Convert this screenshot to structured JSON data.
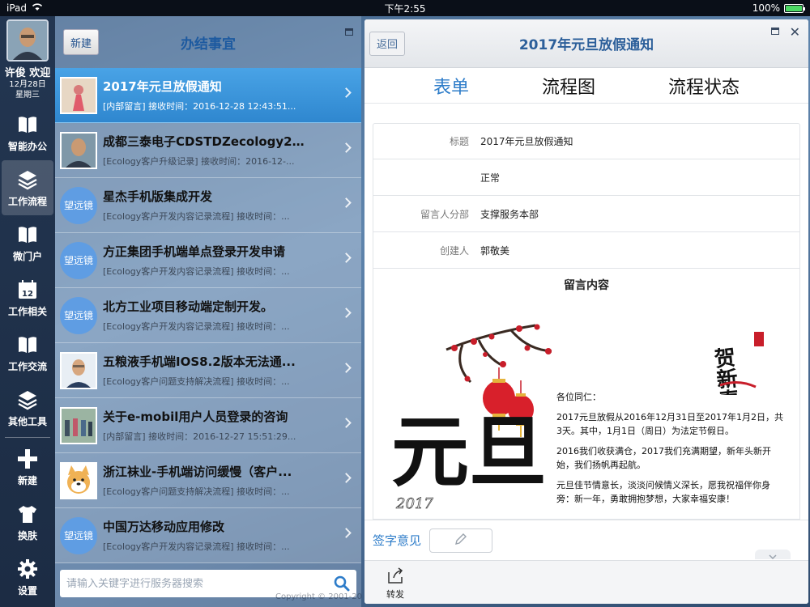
{
  "status": {
    "device": "iPad",
    "time": "下午2:55",
    "battery": "100%"
  },
  "user": {
    "name": "许俊 欢迎",
    "date": "12月28日",
    "weekday": "星期三"
  },
  "rail": [
    {
      "label": "智能办公",
      "icon": "book-icon"
    },
    {
      "label": "工作流程",
      "icon": "layers-icon"
    },
    {
      "label": "微门户",
      "icon": "book-icon"
    },
    {
      "label": "工作相关",
      "icon": "calendar-icon",
      "badge": "12"
    },
    {
      "label": "工作交流",
      "icon": "book-icon"
    },
    {
      "label": "其他工具",
      "icon": "layers-icon"
    },
    {
      "label": "新建",
      "icon": "plus-icon"
    },
    {
      "label": "换肤",
      "icon": "shirt-icon"
    },
    {
      "label": "设置",
      "icon": "gear-icon"
    }
  ],
  "list": {
    "new_label": "新建",
    "title": "办结事宜",
    "logo_text": "望远镜",
    "search_placeholder": "请输入关键字进行服务器搜索",
    "items": [
      {
        "title": "2017年元旦放假通知",
        "sub": "[内部留言]   接收时间：2016-12-28 12:43:51..."
      },
      {
        "title": "成都三泰电子CDSTDZecology20...",
        "sub": "[Ecology客户升级记录]   接收时间：2016-12-..."
      },
      {
        "title": "星杰手机版集成开发",
        "sub": "[Ecology客户开发内容记录流程]   接收时间：..."
      },
      {
        "title": "方正集团手机端单点登录开发申请",
        "sub": "[Ecology客户开发内容记录流程]   接收时间：..."
      },
      {
        "title": "北方工业项目移动端定制开发。",
        "sub": "[Ecology客户开发内容记录流程]   接收时间：..."
      },
      {
        "title": "五粮液手机端IOS8.2版本无法通...",
        "sub": "[Ecology客户问题支持解决流程]   接收时间：..."
      },
      {
        "title": "关于e-mobil用户人员登录的咨询",
        "sub": "[内部留言]   接收时间：2016-12-27 15:51:29..."
      },
      {
        "title": "浙江袜业-手机端访问缓慢（客户...",
        "sub": "[Ecology客户问题支持解决流程]   接收时间：..."
      },
      {
        "title": "中国万达移动应用修改",
        "sub": "[Ecology客户开发内容记录流程]   接收时间：..."
      }
    ]
  },
  "copyright": "Copyright © 2001-20",
  "detail": {
    "back_label": "返回",
    "title": "2017年元旦放假通知",
    "tabs": [
      "表单",
      "流程图",
      "流程状态"
    ],
    "fields": [
      {
        "label": "标题",
        "value": "2017年元旦放假通知"
      },
      {
        "label": "",
        "value": "正常"
      },
      {
        "label": "留言人分部",
        "value": "支撑服务本部"
      },
      {
        "label": "创建人",
        "value": "郭敬美"
      }
    ],
    "msg_title": "留言内容",
    "card": {
      "year": "2017",
      "char": "元旦",
      "greeting_art": "贺新春",
      "salutation": "各位同仁：",
      "p1": "2017元旦放假从2016年12月31日至2017年1月2日，共3天。其中，1月1日（周日）为法定节假日。",
      "p2": "2016我们收获满仓，2017我们充满期望，新年头新开始，我们扬帆再起航。",
      "p3": "元旦佳节情意长，淡淡问候情义深长，愿我祝福伴你身旁：新一年，勇敢拥抱梦想，大家幸福安康！"
    },
    "sign_label": "签字意见",
    "forward_label": "转发"
  }
}
